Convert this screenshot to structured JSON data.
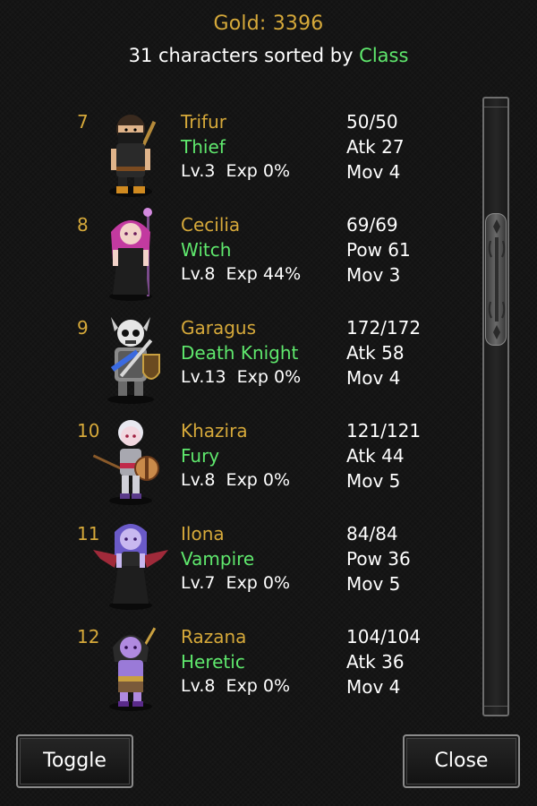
{
  "header": {
    "gold": "Gold: 3396",
    "sort_prefix": "31 characters sorted by ",
    "sort_key": "Class"
  },
  "characters": [
    {
      "index": "7",
      "name": "Trifur",
      "class": "Thief",
      "level": "Lv.3  Exp 0%",
      "hp": "50/50",
      "stat": "Atk 27",
      "mov": "Mov 4"
    },
    {
      "index": "8",
      "name": "Cecilia",
      "class": "Witch",
      "level": "Lv.8  Exp 44%",
      "hp": "69/69",
      "stat": "Pow 61",
      "mov": "Mov 3"
    },
    {
      "index": "9",
      "name": "Garagus",
      "class": "Death Knight",
      "level": "Lv.13  Exp 0%",
      "hp": "172/172",
      "stat": "Atk 58",
      "mov": "Mov 4"
    },
    {
      "index": "10",
      "name": "Khazira",
      "class": "Fury",
      "level": "Lv.8  Exp 0%",
      "hp": "121/121",
      "stat": "Atk 44",
      "mov": "Mov 5"
    },
    {
      "index": "11",
      "name": "Ilona",
      "class": "Vampire",
      "level": "Lv.7  Exp 0%",
      "hp": "84/84",
      "stat": "Pow 36",
      "mov": "Mov 5"
    },
    {
      "index": "12",
      "name": "Razana",
      "class": "Heretic",
      "level": "Lv.8  Exp 0%",
      "hp": "104/104",
      "stat": "Atk 36",
      "mov": "Mov 4"
    }
  ],
  "buttons": {
    "toggle": "Toggle",
    "close": "Close"
  },
  "colors": {
    "gold": "#d6a93a",
    "class_green": "#5fe86d",
    "text_white": "#ffffff",
    "background": "#121212"
  }
}
